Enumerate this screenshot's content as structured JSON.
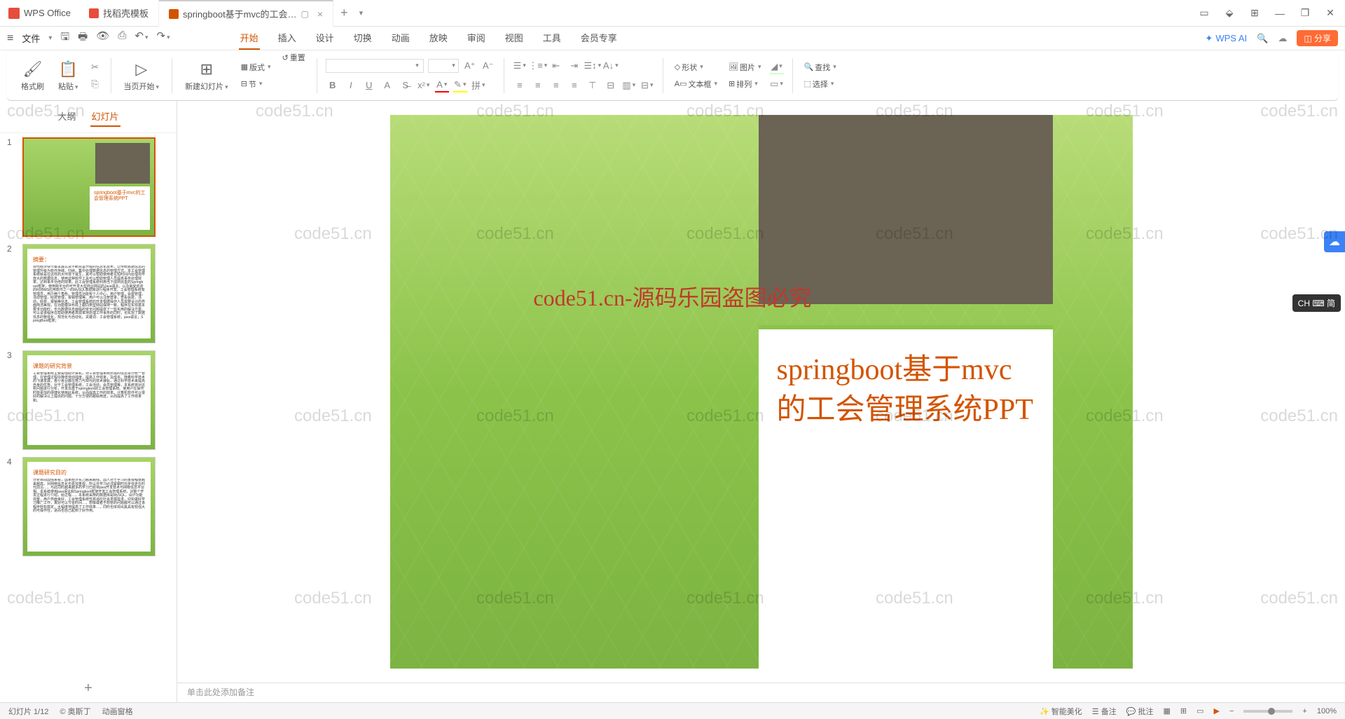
{
  "app": {
    "brand": "WPS Office"
  },
  "tabs": [
    {
      "label": "找稻壳模板",
      "icon": "red"
    },
    {
      "label": "springboot基于mvc的工会…",
      "icon": "orange",
      "active": true
    }
  ],
  "menu": {
    "file": "文件",
    "items": [
      "开始",
      "插入",
      "设计",
      "切换",
      "动画",
      "放映",
      "审阅",
      "视图",
      "工具",
      "会员专享"
    ],
    "active": "开始",
    "wps_ai": "WPS AI",
    "share": "分享"
  },
  "ribbon": {
    "format_painter": "格式刷",
    "paste": "粘贴",
    "start_from": "当页开始",
    "new_slide": "新建幻灯片",
    "layout": "版式",
    "section": "节",
    "reset": "重置",
    "shape": "形状",
    "picture": "图片",
    "textbox": "文本框",
    "arrange": "排列",
    "find": "查找",
    "select": "选择"
  },
  "panel": {
    "tab_outline": "大纲",
    "tab_slides": "幻灯片",
    "slides": [
      {
        "num": "1",
        "title": "springboot基于mvc的工会管理系统PPT",
        "selected": true
      },
      {
        "num": "2",
        "title": "摘要：",
        "body": "现代经济快节奏发展以及不断完善升级的信息化技术，让传统数据信息的管理升级为软件存储，归纳，集中处理数据信息的管理方式。本工会管理系统就是在这样的大环境下诞生，其可以帮助使用者在短时间内处理完毕庞大的数据信息，使用这种软件工具可以帮助管理人员提高事务处理效率，达到事半功倍的效果。此工会管理系统利用当下成熟完善的Springboot框架，使用跨平台的可开发大型商业网站的Java语言，以及最受欢迎的RDBMS应用软件之一的MySQL数据库进行程序开发。工会管理系统有管理员，用户两个角色。管理员功能有个人中心，用户管理，会费管理，活动管理，经费管理，报销管理等。用户可以注册登录，查看会费，活动，经费，报销等信息。工会管理系统的开发根据操作人员需要设计的界面简洁美观，在功能模块布局上跟同类型网站保持一致，程序在实现基本要求功能时，也为数据信息面临的安全问题提供了一些实用的解决方案。可以说该程序在帮助使用者高效率地处理工作事务的同时，也实现了数据信息的整体化，规范化与自动化。关键词：工会管理系统；java语言；SpringBoot框架；"
      },
      {
        "num": "3",
        "title": "课题的研究背景",
        "body": "工会管理系统主要是借助计算机，对工会管理系统所需的信息进行统一管理，在管理过程中降低劳动强度，提高工作效率，及成本。随着科学技术的飞速发展，各行各业都在努力与现代的技术接轨，通过科学技术来提高自身的优势，对于工会管理系统，工会活动，会员管理等，本系统将对这些问题进行分析，开发出基于springboot的工会管理系统。使用户在操作时能更加的便捷化使用此系统，从而提高工作的效率。计算机软件可以很好的解决以上提出的问题。十分方便的跟踪用途，从而提高了工作效率和。"
      },
      {
        "num": "4",
        "title": "课题研究目的",
        "body": "分析目前国情来看，国家经济实力越来越强，国人对于学习的重视程度越来越高，对网络信息化也更加重视，所以许学习必须紧跟时代步伐走在时代前沿…，与此同时越来越多的学习已经将java开发技术与网络信息平台相。本系统使用java语言和Springboot框架开发工会管理系统，对整个开发过程进行介绍，给过程…，本系统采用的数据库是MySQL，设计功能完整，用户界面良好，工会管理系统性高适应社会发展需求，切实做好学习推广工作，真好可以节省时间…，想像或者不想管的问题都可以通过该程序轻松搞定，大幅度地提高了工作效率…，同时也体现出其具有较强大的可操作性，进而也自己起到了好作用。"
      }
    ]
  },
  "slide": {
    "title": "springboot基于mvc的工会管理系统PPT"
  },
  "notes": "单击此处添加备注",
  "status": {
    "left1": "幻灯片 1/12",
    "left2": "© 奥斯丁",
    "left3": "动画窗格",
    "r1": "智能美化",
    "r2": "备注",
    "r3": "批注",
    "zoom": "100%"
  },
  "watermark": "code51.cn",
  "watermark_center": "code51.cn-源码乐园盗图必究",
  "ime": "CH ⌨ 简"
}
